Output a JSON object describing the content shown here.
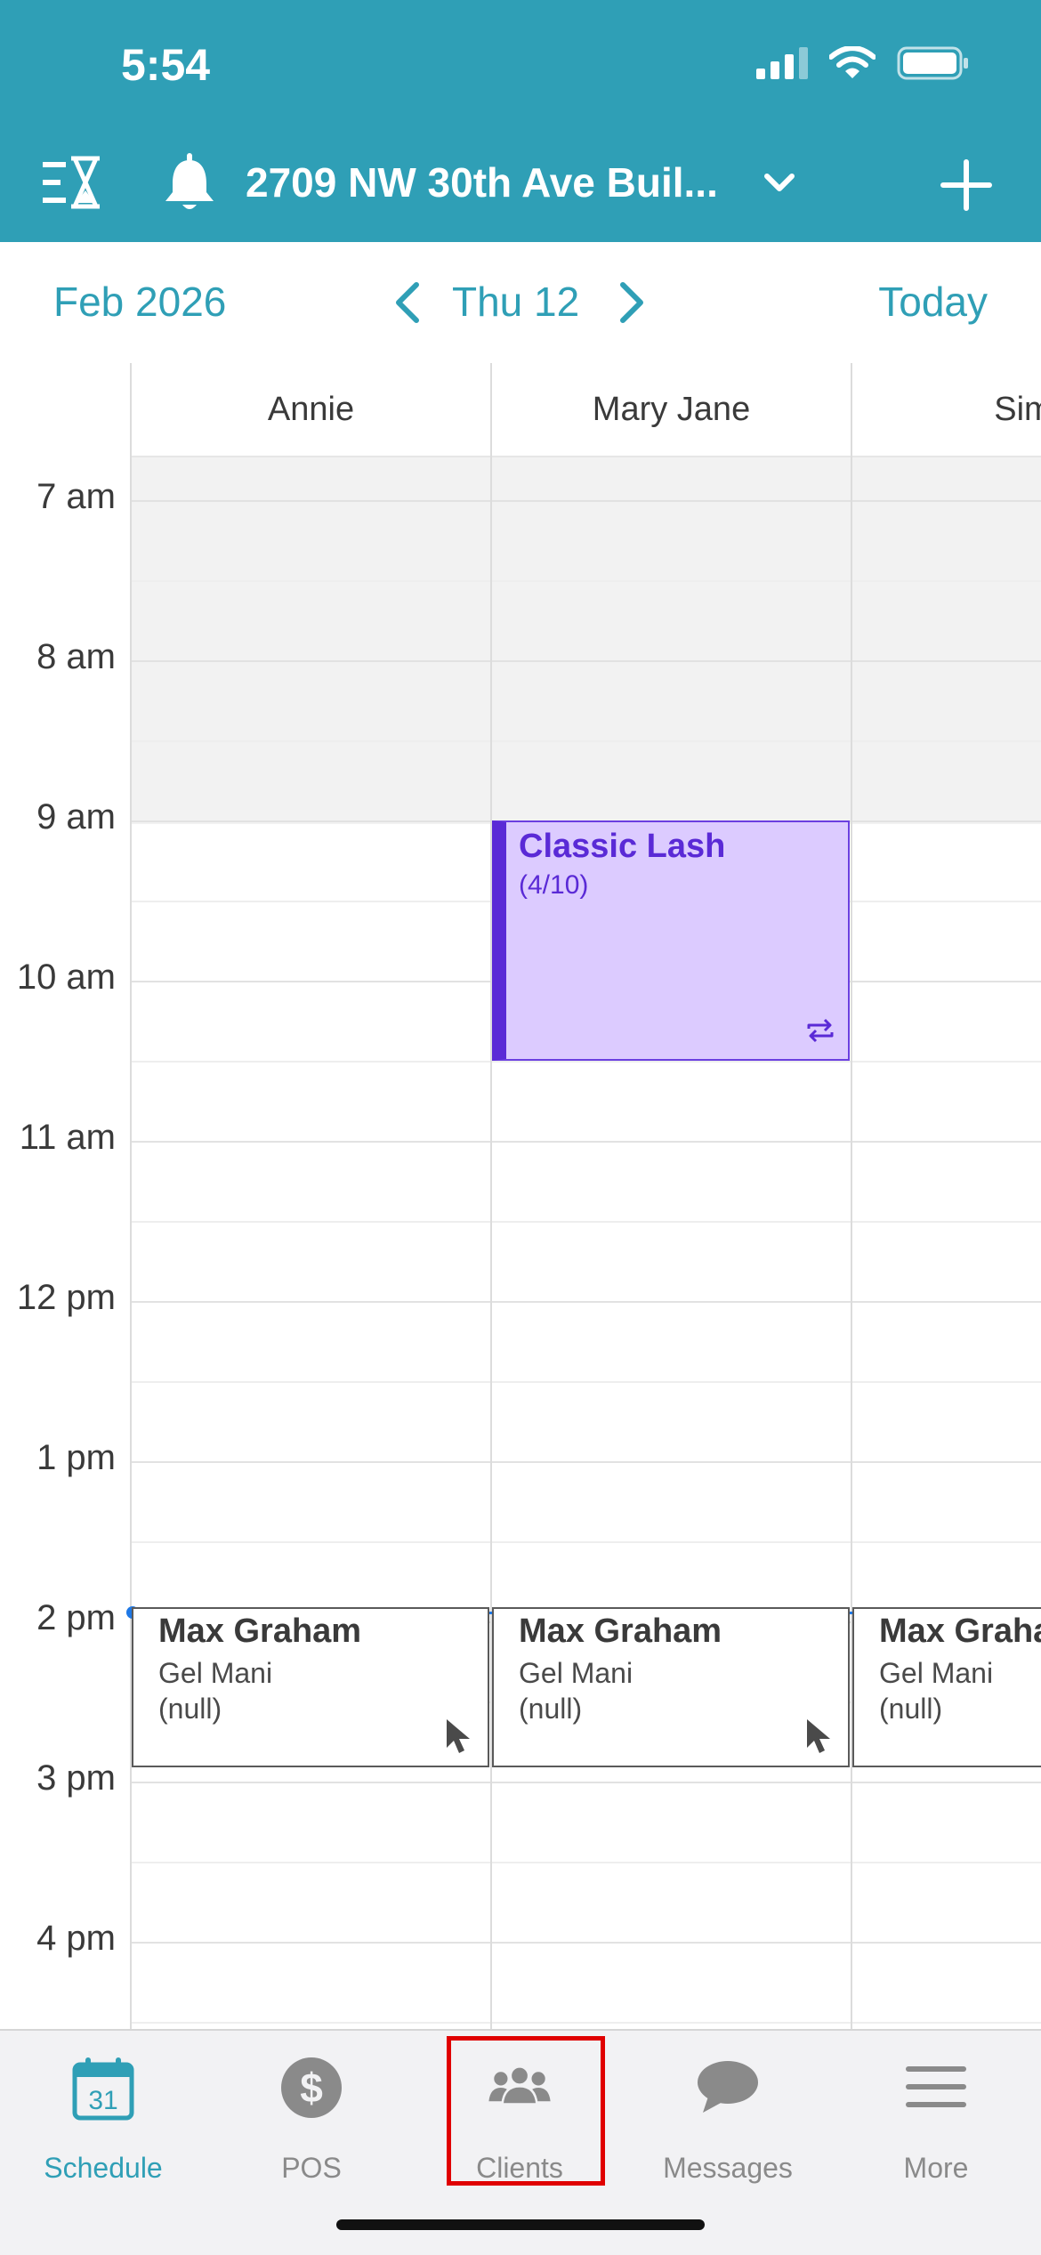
{
  "status_bar": {
    "time": "5:54"
  },
  "header": {
    "location": "2709 NW 30th Ave Buil...",
    "colors": {
      "background": "#2f9fb6"
    }
  },
  "date_nav": {
    "month": "Feb 2026",
    "day": "Thu 12",
    "today": "Today"
  },
  "staff": [
    "Annie",
    "Mary Jane",
    "Simc"
  ],
  "times": [
    "7 am",
    "8 am",
    "9 am",
    "10 am",
    "11 am",
    "12 pm",
    "1 pm",
    "2 pm",
    "3 pm",
    "4 pm"
  ],
  "appointments": {
    "classic_lash": {
      "title": "Classic Lash",
      "subtitle": "(4/10)",
      "color": "#5a2ad6"
    },
    "max_annie": {
      "name": "Max Graham",
      "service": "Gel Mani",
      "note": "(null)"
    },
    "max_mary": {
      "name": "Max Graham",
      "service": "Gel Mani",
      "note": "(null)"
    },
    "max_simc": {
      "name": "Max Graha",
      "service": "Gel Mani",
      "note": "(null)"
    }
  },
  "tabs": [
    {
      "label": "Schedule",
      "icon": "calendar-icon"
    },
    {
      "label": "POS",
      "icon": "dollar-icon"
    },
    {
      "label": "Clients",
      "icon": "clients-icon"
    },
    {
      "label": "Messages",
      "icon": "chat-icon"
    },
    {
      "label": "More",
      "icon": "menu-icon"
    }
  ],
  "calendar_icon_number": "31"
}
